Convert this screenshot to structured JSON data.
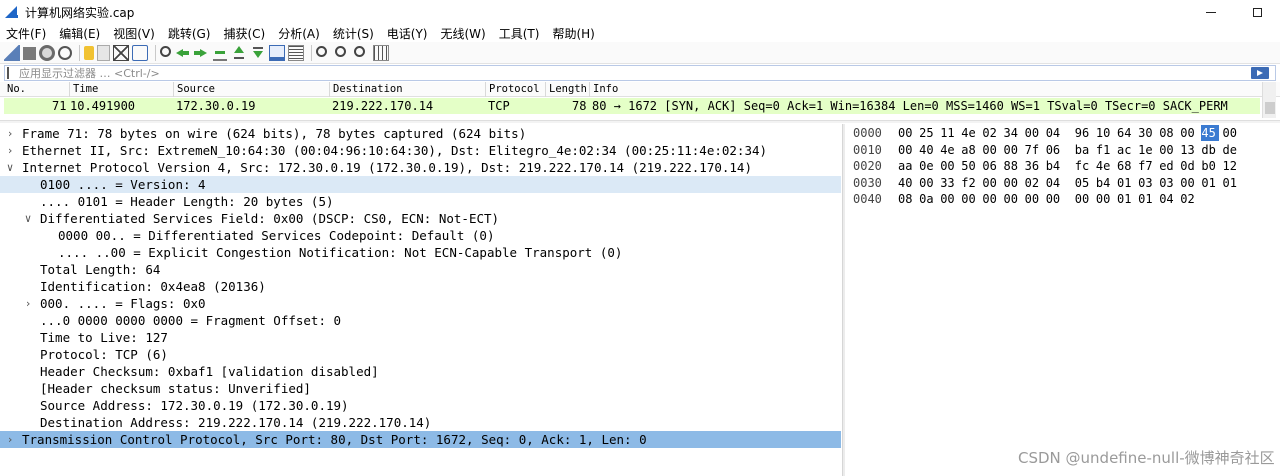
{
  "window": {
    "title": "计算机网络实验.cap",
    "minimize": "",
    "maximize": ""
  },
  "menu": [
    "文件(F)",
    "编辑(E)",
    "视图(V)",
    "跳转(G)",
    "捕获(C)",
    "分析(A)",
    "统计(S)",
    "电话(Y)",
    "无线(W)",
    "工具(T)",
    "帮助(H)"
  ],
  "toolbar": {
    "icons": [
      "shark-fin-icon",
      "stop-icon",
      "restart-icon",
      "options-icon",
      "open-folder-icon",
      "file-icon",
      "close-file-icon",
      "reload-icon",
      "find-icon",
      "back-arrow-icon",
      "forward-arrow-icon",
      "go-to-packet-icon",
      "first-packet-icon",
      "last-packet-icon",
      "autoscroll-icon",
      "colorize-icon",
      "zoom-in-icon",
      "zoom-out-icon",
      "zoom-reset-icon",
      "resize-columns-icon"
    ]
  },
  "filter": {
    "placeholder": "应用显示过滤器 … <Ctrl-/>"
  },
  "packet_list": {
    "columns": [
      "No.",
      "Time",
      "Source",
      "Destination",
      "Protocol",
      "Length",
      "Info"
    ],
    "rows": [
      {
        "no": "71",
        "time": "10.491900",
        "source": "172.30.0.19",
        "destination": "219.222.170.14",
        "protocol": "TCP",
        "length": "78",
        "info": "80 → 1672 [SYN, ACK] Seq=0 Ack=1 Win=16384 Len=0 MSS=1460 WS=1 TSval=0 TSecr=0 SACK_PERM",
        "row_color": "#e4ffc7"
      }
    ]
  },
  "details": [
    {
      "text": "Frame 71: 78 bytes on wire (624 bits), 78 bytes captured (624 bits)",
      "indent": 0,
      "toggle": "collapsed",
      "state": "normal"
    },
    {
      "text": "Ethernet II, Src: ExtremeN_10:64:30 (00:04:96:10:64:30), Dst: Elitegro_4e:02:34 (00:25:11:4e:02:34)",
      "indent": 0,
      "toggle": "collapsed",
      "state": "normal"
    },
    {
      "text": "Internet Protocol Version 4, Src: 172.30.0.19 (172.30.0.19), Dst: 219.222.170.14 (219.222.170.14)",
      "indent": 0,
      "toggle": "expanded",
      "state": "normal"
    },
    {
      "text": "0100 .... = Version: 4",
      "indent": 1,
      "toggle": "none",
      "state": "highlight"
    },
    {
      "text": ".... 0101 = Header Length: 20 bytes (5)",
      "indent": 1,
      "toggle": "none",
      "state": "normal"
    },
    {
      "text": "Differentiated Services Field: 0x00 (DSCP: CS0, ECN: Not-ECT)",
      "indent": 1,
      "toggle": "expanded",
      "state": "normal"
    },
    {
      "text": "0000 00.. = Differentiated Services Codepoint: Default (0)",
      "indent": 2,
      "toggle": "none",
      "state": "normal"
    },
    {
      "text": ".... ..00 = Explicit Congestion Notification: Not ECN-Capable Transport (0)",
      "indent": 2,
      "toggle": "none",
      "state": "normal"
    },
    {
      "text": "Total Length: 64",
      "indent": 1,
      "toggle": "none",
      "state": "normal"
    },
    {
      "text": "Identification: 0x4ea8 (20136)",
      "indent": 1,
      "toggle": "none",
      "state": "normal"
    },
    {
      "text": "000. .... = Flags: 0x0",
      "indent": 1,
      "toggle": "collapsed",
      "state": "normal"
    },
    {
      "text": "...0 0000 0000 0000 = Fragment Offset: 0",
      "indent": 1,
      "toggle": "none",
      "state": "normal"
    },
    {
      "text": "Time to Live: 127",
      "indent": 1,
      "toggle": "none",
      "state": "normal"
    },
    {
      "text": "Protocol: TCP (6)",
      "indent": 1,
      "toggle": "none",
      "state": "normal"
    },
    {
      "text": "Header Checksum: 0xbaf1 [validation disabled]",
      "indent": 1,
      "toggle": "none",
      "state": "normal"
    },
    {
      "text": "[Header checksum status: Unverified]",
      "indent": 1,
      "toggle": "none",
      "state": "normal"
    },
    {
      "text": "Source Address: 172.30.0.19 (172.30.0.19)",
      "indent": 1,
      "toggle": "none",
      "state": "normal"
    },
    {
      "text": "Destination Address: 219.222.170.14 (219.222.170.14)",
      "indent": 1,
      "toggle": "none",
      "state": "normal"
    },
    {
      "text": "Transmission Control Protocol, Src Port: 80, Dst Port: 1672, Seq: 0, Ack: 1, Len: 0",
      "indent": 0,
      "toggle": "collapsed",
      "state": "selected"
    }
  ],
  "hex": [
    {
      "offset": "0000",
      "bytes": [
        "00",
        "25",
        "11",
        "4e",
        "02",
        "34",
        "00",
        "04",
        "96",
        "10",
        "64",
        "30",
        "08",
        "00",
        "45",
        "00"
      ]
    },
    {
      "offset": "0010",
      "bytes": [
        "00",
        "40",
        "4e",
        "a8",
        "00",
        "00",
        "7f",
        "06",
        "ba",
        "f1",
        "ac",
        "1e",
        "00",
        "13",
        "db",
        "de"
      ]
    },
    {
      "offset": "0020",
      "bytes": [
        "aa",
        "0e",
        "00",
        "50",
        "06",
        "88",
        "36",
        "b4",
        "fc",
        "4e",
        "68",
        "f7",
        "ed",
        "0d",
        "b0",
        "12"
      ]
    },
    {
      "offset": "0030",
      "bytes": [
        "40",
        "00",
        "33",
        "f2",
        "00",
        "00",
        "02",
        "04",
        "05",
        "b4",
        "01",
        "03",
        "03",
        "00",
        "01",
        "01"
      ]
    },
    {
      "offset": "0040",
      "bytes": [
        "08",
        "0a",
        "00",
        "00",
        "00",
        "00",
        "00",
        "00",
        "00",
        "00",
        "01",
        "01",
        "04",
        "02"
      ]
    }
  ],
  "hex_highlight": {
    "row": 0,
    "index": 14
  },
  "watermark": "CSDN @undefine-null-微博神奇社区"
}
